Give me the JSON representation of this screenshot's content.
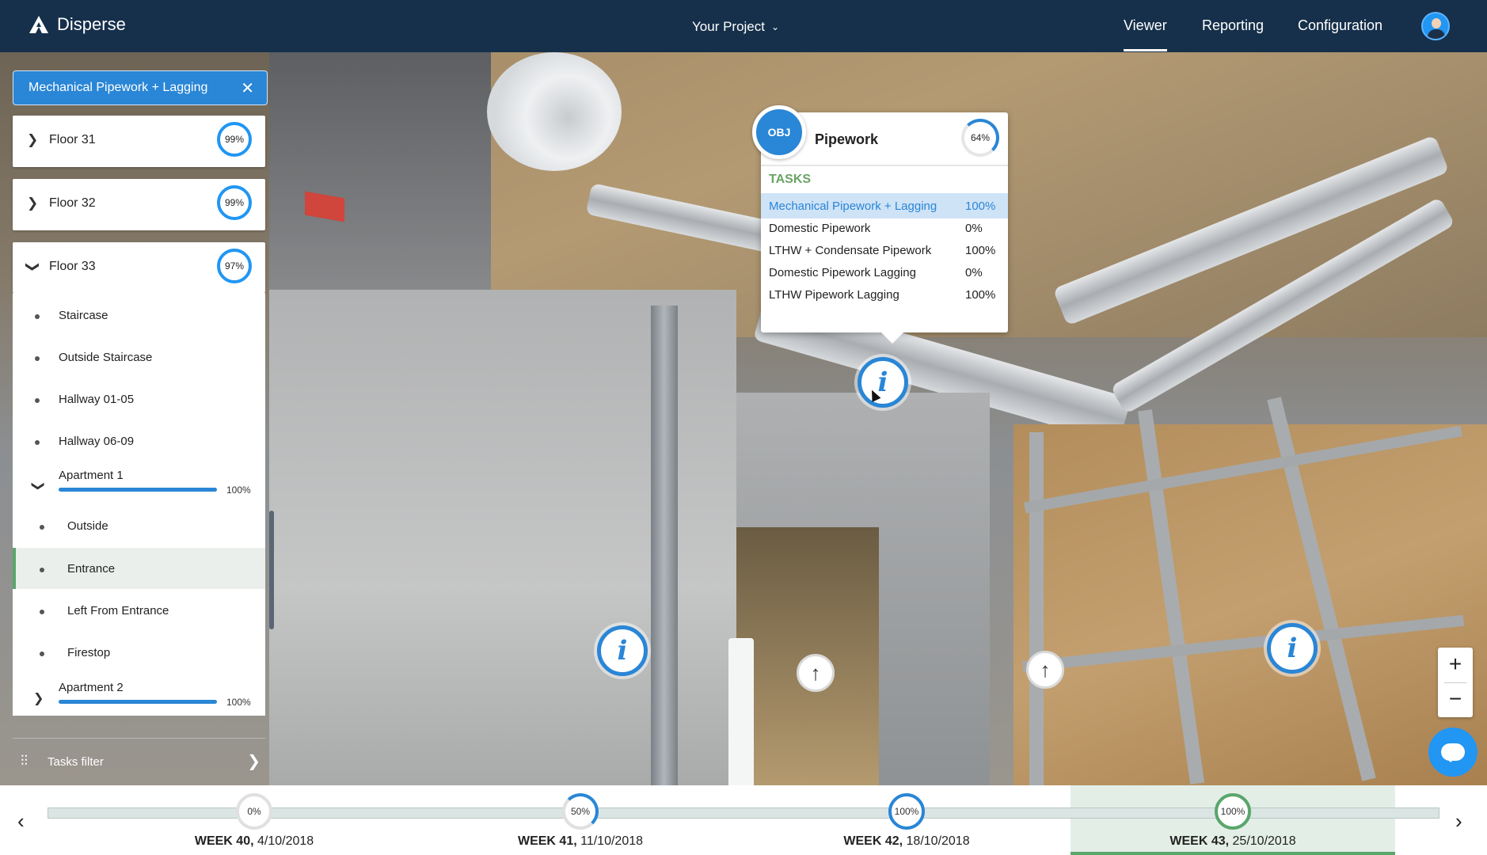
{
  "header": {
    "app_name": "Disperse",
    "project_selector": "Your Project",
    "nav": [
      {
        "label": "Viewer",
        "active": true
      },
      {
        "label": "Reporting",
        "active": false
      },
      {
        "label": "Configuration",
        "active": false
      }
    ]
  },
  "sidebar": {
    "active_filter": "Mechanical Pipework + Lagging",
    "floors": [
      {
        "name": "Floor 31",
        "progress": "99%"
      },
      {
        "name": "Floor 32",
        "progress": "99%"
      },
      {
        "name": "Floor 33",
        "progress": "97%"
      }
    ],
    "floor33_items": [
      "Staircase",
      "Outside Staircase",
      "Hallway 01-05",
      "Hallway 06-09"
    ],
    "apartment1": {
      "name": "Apartment 1",
      "progress": "100%",
      "progress_value": 1.0
    },
    "apartment1_items": [
      "Outside",
      "Entrance",
      "Left From Entrance",
      "Firestop"
    ],
    "selected_item": "Entrance",
    "apartment2": {
      "name": "Apartment 2",
      "progress": "100%",
      "progress_value": 1.0
    },
    "tasks_filter_label": "Tasks filter"
  },
  "popup": {
    "badge": "OBJ",
    "title": "Pipework",
    "progress": "64%",
    "progress_value": 0.64,
    "tasks_heading": "TASKS",
    "tasks": [
      {
        "name": "Mechanical Pipework + Lagging",
        "pct": "100%",
        "highlighted": true
      },
      {
        "name": "Domestic Pipework",
        "pct": "0%",
        "highlighted": false
      },
      {
        "name": "LTHW + Condensate Pipework",
        "pct": "100%",
        "highlighted": false
      },
      {
        "name": "Domestic Pipework Lagging",
        "pct": "0%",
        "highlighted": false
      },
      {
        "name": "LTHW Pipework Lagging",
        "pct": "100%",
        "highlighted": false
      }
    ]
  },
  "markers": {
    "info_icon": "i"
  },
  "zoom": {
    "in": "+",
    "out": "−"
  },
  "timeline": {
    "weeks": [
      {
        "week": "WEEK 40,",
        "date": " 4/10/2018",
        "progress": "0%",
        "color": "#e0e0e0"
      },
      {
        "week": "WEEK 41,",
        "date": " 11/10/2018",
        "progress": "50%",
        "color": "#2a86d6"
      },
      {
        "week": "WEEK 42,",
        "date": " 18/10/2018",
        "progress": "100%",
        "color": "#2a86d6"
      },
      {
        "week": "WEEK 43,",
        "date": " 25/10/2018",
        "progress": "100%",
        "color": "#5aa66b"
      }
    ],
    "active_week_index": 3
  },
  "colors": {
    "accent": "#2a86d6",
    "nav_bg": "#16304b",
    "tasks_green": "#6aa463",
    "selected_green": "#5aa66b"
  }
}
